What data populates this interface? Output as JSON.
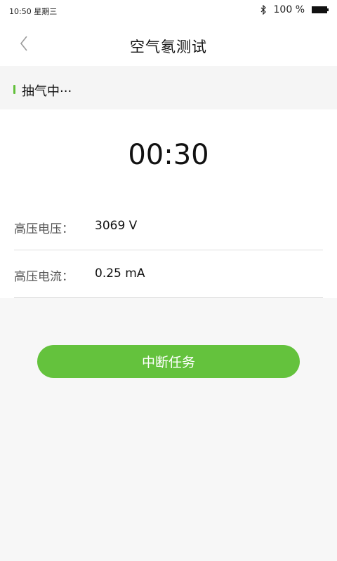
{
  "status_bar": {
    "time": "10:50 星期三",
    "battery": "100 %",
    "icons": [
      "bluetooth-icon",
      "battery-icon"
    ]
  },
  "nav": {
    "back_icon": "chevron-left-icon",
    "title": "空气氡测试"
  },
  "section": {
    "status": "抽气中···"
  },
  "timer": "00:30",
  "readings": [
    {
      "label": "高压电压：",
      "value": "3069 V"
    },
    {
      "label": "高压电流：",
      "value": "0.25 mA"
    }
  ],
  "action": {
    "label": "中断任务"
  },
  "colors": {
    "accent": "#64c23d",
    "background": "#f7f7f7"
  }
}
